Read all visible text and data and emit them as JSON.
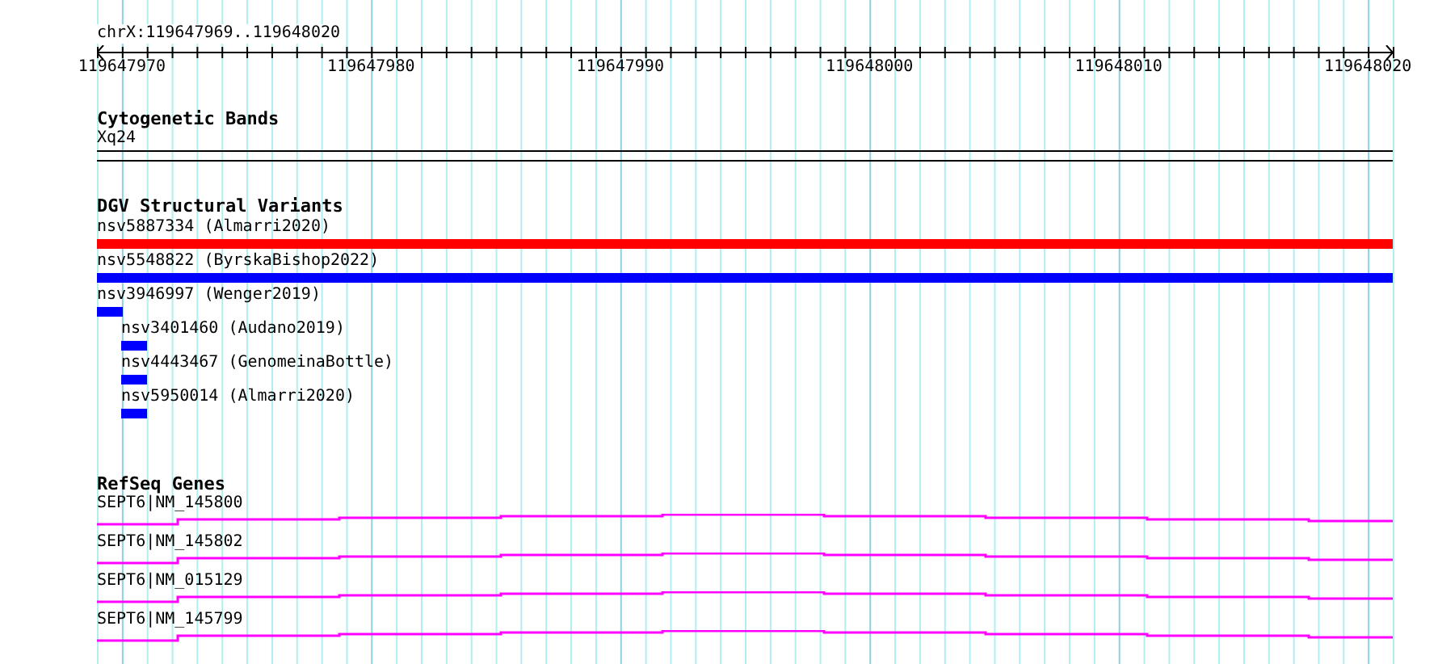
{
  "location": "chrX:119647969..119648020",
  "ruler": {
    "ticks": [
      "119647970",
      "119647980",
      "119647990",
      "119648000",
      "119648010",
      "119648020"
    ]
  },
  "tracks": [
    {
      "kind": "bands",
      "title": "Cytogenetic Bands",
      "label": "Xq24"
    },
    {
      "kind": "variants",
      "title": "DGV Structural Variants",
      "features": [
        {
          "label": "nsv5887334 (Almarri2020)",
          "kind": "full",
          "color": "#ff0000"
        },
        {
          "label": "nsv5548822 (ByrskaBishop2022)",
          "kind": "full",
          "color": "#0000ff"
        },
        {
          "label": "nsv3946997 (Wenger2019)",
          "kind": "start",
          "color": "#0000ff"
        },
        {
          "label": "nsv3401460 (Audano2019)",
          "kind": "inset",
          "color": "#0000ff"
        },
        {
          "label": "nsv4443467 (GenomeinaBottle)",
          "kind": "inset",
          "color": "#0000ff"
        },
        {
          "label": "nsv5950014 (Almarri2020)",
          "kind": "inset",
          "color": "#0000ff"
        }
      ]
    },
    {
      "kind": "genes",
      "title": "RefSeq Genes",
      "features": [
        {
          "label": "SEPT6|NM_145800"
        },
        {
          "label": "SEPT6|NM_145802"
        },
        {
          "label": "SEPT6|NM_015129"
        },
        {
          "label": "SEPT6|NM_145799"
        }
      ]
    }
  ]
}
